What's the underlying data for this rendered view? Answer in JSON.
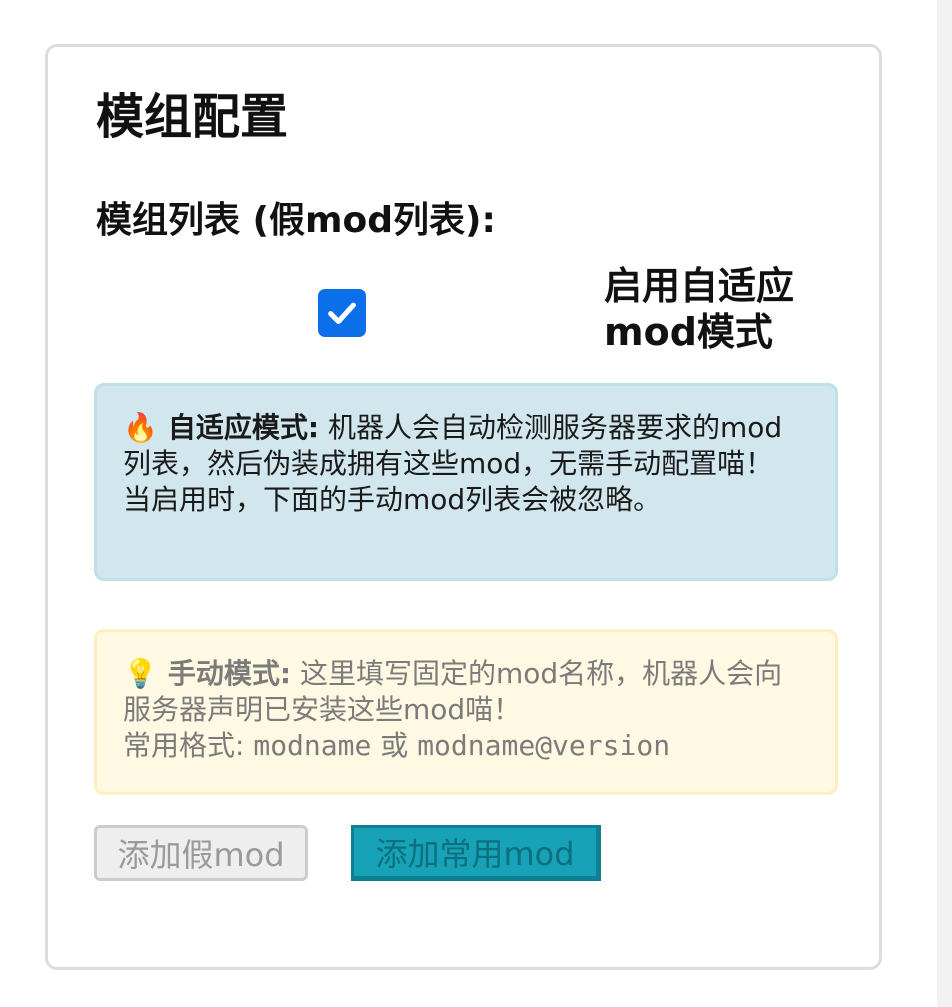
{
  "panel": {
    "title": "模组配置",
    "mod_list_label": "模组列表 (假mod列表):"
  },
  "adaptive_checkbox": {
    "checked": true,
    "label": "启用自适应mod模式"
  },
  "info_box": {
    "icon": "fire-icon",
    "glyph": "🔥",
    "heading": "自适应模式:",
    "text": " 机器人会自动检测服务器要求的mod列表，然后伪装成拥有这些mod，无需手动配置喵！",
    "note": "当启用时，下面的手动mod列表会被忽略。"
  },
  "warn_box": {
    "icon": "lightbulb-icon",
    "glyph": "💡",
    "heading": "手动模式:",
    "text": " 这里填写固定的mod名称，机器人会向服务器声明已安装这些mod喵！",
    "format_label": "常用格式:",
    "format_example_1": "modname",
    "format_or": "或",
    "format_example_2": "modname@version"
  },
  "buttons": {
    "add_fake_mod": "添加假mod",
    "add_common_mod": "添加常用mod"
  },
  "colors": {
    "checkbox": "#0a6fe8",
    "info_bg": "#d1e7ed",
    "warn_bg": "#fff8e2",
    "primary_button": "#17a2b8"
  }
}
